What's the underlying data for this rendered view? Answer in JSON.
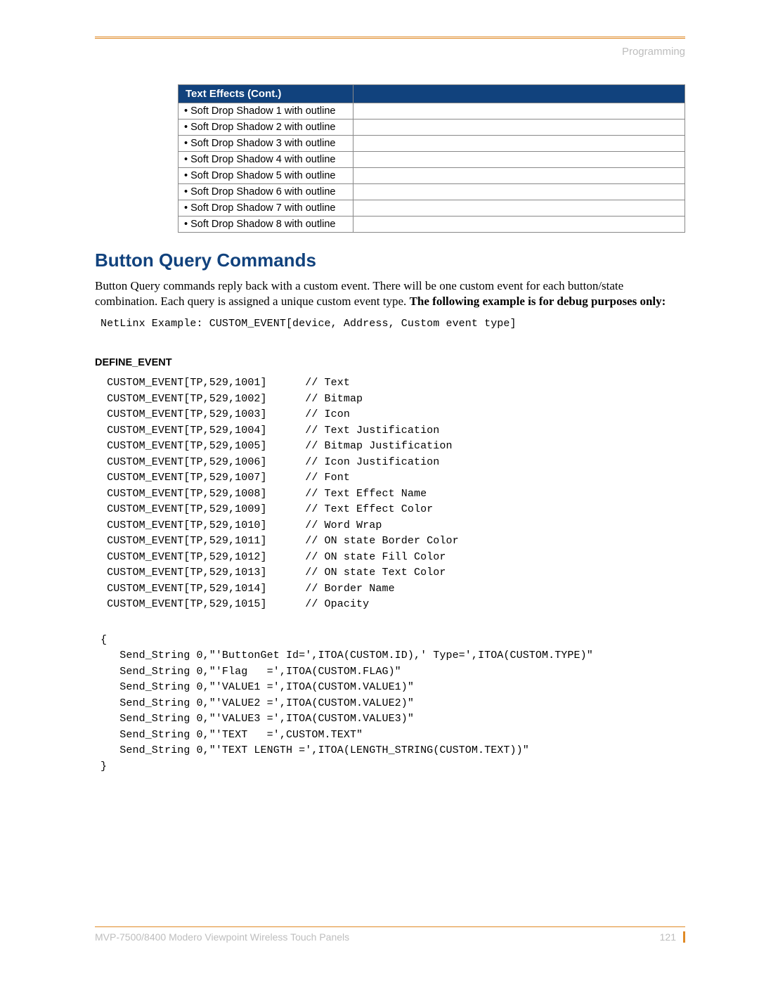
{
  "section_label": "Programming",
  "table": {
    "header": "Text Effects (Cont.)",
    "rows": [
      "• Soft Drop Shadow 1 with outline",
      "• Soft Drop Shadow 2 with outline",
      "• Soft Drop Shadow 3 with outline",
      "• Soft Drop Shadow 4 with outline",
      "• Soft Drop Shadow 5 with outline",
      "• Soft Drop Shadow 6 with outline",
      "• Soft Drop Shadow 7 with outline",
      "• Soft Drop Shadow 8 with outline"
    ]
  },
  "heading": "Button Query Commands",
  "paragraph": {
    "plain": "Button Query commands reply back with a custom event. There will be one custom event for each button/state combination. Each query is assigned a unique custom event type. ",
    "bold": "The following example is for debug purposes only:"
  },
  "example_line": "NetLinx Example: CUSTOM_EVENT[device, Address, Custom event type]",
  "define_event_label": "DEFINE_EVENT",
  "events": [
    {
      "code": "CUSTOM_EVENT[TP,529,1001]",
      "comment": "// Text"
    },
    {
      "code": "CUSTOM_EVENT[TP,529,1002]",
      "comment": "// Bitmap"
    },
    {
      "code": "CUSTOM_EVENT[TP,529,1003]",
      "comment": "// Icon"
    },
    {
      "code": "CUSTOM_EVENT[TP,529,1004]",
      "comment": "// Text Justification"
    },
    {
      "code": "CUSTOM_EVENT[TP,529,1005]",
      "comment": "// Bitmap Justification"
    },
    {
      "code": "CUSTOM_EVENT[TP,529,1006]",
      "comment": "// Icon Justification"
    },
    {
      "code": "CUSTOM_EVENT[TP,529,1007]",
      "comment": "// Font"
    },
    {
      "code": "CUSTOM_EVENT[TP,529,1008]",
      "comment": "// Text Effect Name"
    },
    {
      "code": "CUSTOM_EVENT[TP,529,1009]",
      "comment": "// Text Effect Color"
    },
    {
      "code": "CUSTOM_EVENT[TP,529,1010]",
      "comment": "// Word Wrap"
    },
    {
      "code": "CUSTOM_EVENT[TP,529,1011]",
      "comment": "// ON state Border Color"
    },
    {
      "code": "CUSTOM_EVENT[TP,529,1012]",
      "comment": "// ON state Fill Color"
    },
    {
      "code": "CUSTOM_EVENT[TP,529,1013]",
      "comment": "// ON state Text Color"
    },
    {
      "code": "CUSTOM_EVENT[TP,529,1014]",
      "comment": "// Border Name"
    },
    {
      "code": "CUSTOM_EVENT[TP,529,1015]",
      "comment": "// Opacity"
    }
  ],
  "block": [
    "{",
    "   Send_String 0,\"'ButtonGet Id=',ITOA(CUSTOM.ID),' Type=',ITOA(CUSTOM.TYPE)\"",
    "   Send_String 0,\"'Flag   =',ITOA(CUSTOM.FLAG)\"",
    "   Send_String 0,\"'VALUE1 =',ITOA(CUSTOM.VALUE1)\"",
    "   Send_String 0,\"'VALUE2 =',ITOA(CUSTOM.VALUE2)\"",
    "   Send_String 0,\"'VALUE3 =',ITOA(CUSTOM.VALUE3)\"",
    "   Send_String 0,\"'TEXT   =',CUSTOM.TEXT\"",
    "   Send_String 0,\"'TEXT LENGTH =',ITOA(LENGTH_STRING(CUSTOM.TEXT))\"",
    "}"
  ],
  "footer": {
    "left": "MVP-7500/8400 Modero Viewpoint Wireless Touch Panels",
    "page": "121"
  }
}
